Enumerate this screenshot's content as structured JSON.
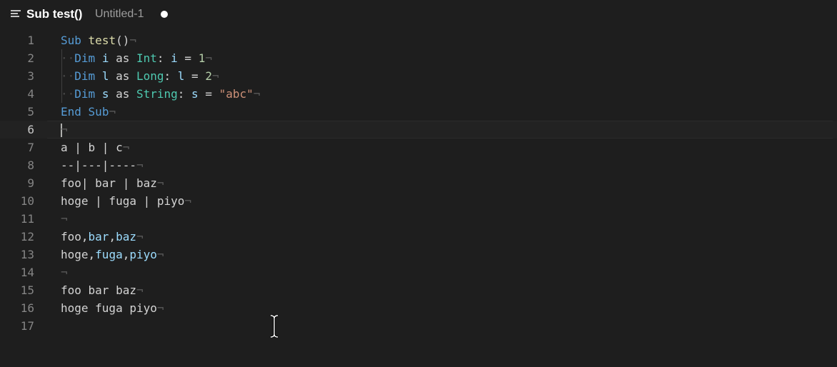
{
  "tab": {
    "title": "Sub test()",
    "filename": "Untitled-1",
    "icon": "outline-list-icon",
    "modified_indicator": "unsaved-dot-icon"
  },
  "editor": {
    "current_line": 6,
    "lines": [
      {
        "n": "1",
        "tokens": [
          {
            "t": "Sub",
            "c": "kw"
          },
          {
            "t": " "
          },
          {
            "t": "test",
            "c": "fn"
          },
          {
            "t": "()"
          },
          {
            "t": "¬",
            "c": "eol"
          }
        ]
      },
      {
        "n": "2",
        "tokens": [
          {
            "t": "··",
            "c": "ws"
          },
          {
            "t": "Dim",
            "c": "kw"
          },
          {
            "t": " "
          },
          {
            "t": "i",
            "c": "var"
          },
          {
            "t": " as "
          },
          {
            "t": "Int",
            "c": "ty"
          },
          {
            "t": ": "
          },
          {
            "t": "i",
            "c": "var"
          },
          {
            "t": " = "
          },
          {
            "t": "1",
            "c": "num"
          },
          {
            "t": "¬",
            "c": "eol"
          }
        ]
      },
      {
        "n": "3",
        "tokens": [
          {
            "t": "··",
            "c": "ws"
          },
          {
            "t": "Dim",
            "c": "kw"
          },
          {
            "t": " "
          },
          {
            "t": "l",
            "c": "var"
          },
          {
            "t": " as "
          },
          {
            "t": "Long",
            "c": "ty"
          },
          {
            "t": ": "
          },
          {
            "t": "l",
            "c": "var"
          },
          {
            "t": " = "
          },
          {
            "t": "2",
            "c": "num"
          },
          {
            "t": "¬",
            "c": "eol"
          }
        ]
      },
      {
        "n": "4",
        "tokens": [
          {
            "t": "··",
            "c": "ws"
          },
          {
            "t": "Dim",
            "c": "kw"
          },
          {
            "t": " "
          },
          {
            "t": "s",
            "c": "var"
          },
          {
            "t": " as "
          },
          {
            "t": "String",
            "c": "ty"
          },
          {
            "t": ": "
          },
          {
            "t": "s",
            "c": "var"
          },
          {
            "t": " = "
          },
          {
            "t": "\"abc\"",
            "c": "str"
          },
          {
            "t": "¬",
            "c": "eol"
          }
        ]
      },
      {
        "n": "5",
        "tokens": [
          {
            "t": "End",
            "c": "kw"
          },
          {
            "t": " "
          },
          {
            "t": "Sub",
            "c": "kw"
          },
          {
            "t": "¬",
            "c": "eol"
          }
        ]
      },
      {
        "n": "6",
        "tokens": [
          {
            "t": "¬",
            "c": "eol"
          }
        ]
      },
      {
        "n": "7",
        "tokens": [
          {
            "t": "a | b | c"
          },
          {
            "t": "¬",
            "c": "eol"
          }
        ]
      },
      {
        "n": "8",
        "tokens": [
          {
            "t": "--|---|----"
          },
          {
            "t": "¬",
            "c": "eol"
          }
        ]
      },
      {
        "n": "9",
        "tokens": [
          {
            "t": "foo| bar | baz"
          },
          {
            "t": "¬",
            "c": "eol"
          }
        ]
      },
      {
        "n": "10",
        "tokens": [
          {
            "t": "hoge | fuga | piyo"
          },
          {
            "t": "¬",
            "c": "eol"
          }
        ]
      },
      {
        "n": "11",
        "tokens": [
          {
            "t": "¬",
            "c": "eol"
          }
        ]
      },
      {
        "n": "12",
        "tokens": [
          {
            "t": "foo,"
          },
          {
            "t": "bar",
            "c": "var"
          },
          {
            "t": ","
          },
          {
            "t": "baz",
            "c": "var"
          },
          {
            "t": "¬",
            "c": "eol"
          }
        ]
      },
      {
        "n": "13",
        "tokens": [
          {
            "t": "hoge,"
          },
          {
            "t": "fuga",
            "c": "var"
          },
          {
            "t": ","
          },
          {
            "t": "piyo",
            "c": "var"
          },
          {
            "t": "¬",
            "c": "eol"
          }
        ]
      },
      {
        "n": "14",
        "tokens": [
          {
            "t": "¬",
            "c": "eol"
          }
        ]
      },
      {
        "n": "15",
        "tokens": [
          {
            "t": "foo bar baz"
          },
          {
            "t": "¬",
            "c": "eol"
          }
        ]
      },
      {
        "n": "16",
        "tokens": [
          {
            "t": "hoge fuga piyo"
          },
          {
            "t": "¬",
            "c": "eol"
          }
        ]
      },
      {
        "n": "17",
        "tokens": []
      }
    ]
  },
  "colors": {
    "background": "#1e1e1e",
    "keyword": "#569cd6",
    "function": "#dcdcaa",
    "type": "#4ec9b0",
    "variable": "#9cdcfe",
    "number": "#b5cea8",
    "string": "#ce9178",
    "line_number": "#858585",
    "text": "#d4d4d4"
  },
  "cursor": {
    "icon": "i-beam-cursor-icon"
  }
}
